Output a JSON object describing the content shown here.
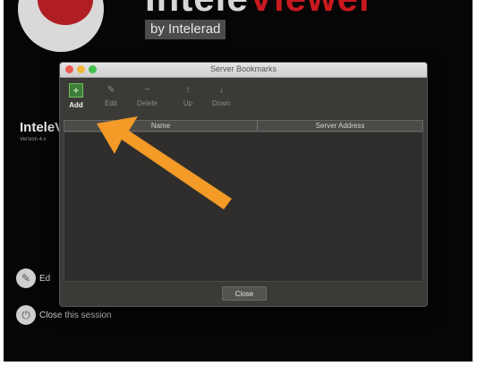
{
  "background_app": {
    "brand_primary": "Intele",
    "brand_secondary": "Viewer",
    "by_line": "by Intelerad",
    "title": "InteleViewer",
    "version": "Version 4.x",
    "actions": [
      {
        "label": "Edit",
        "icon": "pencil-icon"
      },
      {
        "label": "Close this session",
        "icon": "power-icon"
      }
    ],
    "colors": {
      "brand_red": "#c8191f",
      "background": "#060607"
    }
  },
  "dialog": {
    "title": "Server Bookmarks",
    "toolbar": {
      "add_label": "Add",
      "edit_label": "Edit",
      "delete_label": "Delete",
      "up_label": "Up",
      "down_label": "Down"
    },
    "table": {
      "columns": [
        "Name",
        "Server Address"
      ],
      "rows": []
    },
    "close_label": "Close"
  },
  "annotation": {
    "type": "arrow",
    "color": "#f39a27",
    "points_to": "add-button"
  }
}
